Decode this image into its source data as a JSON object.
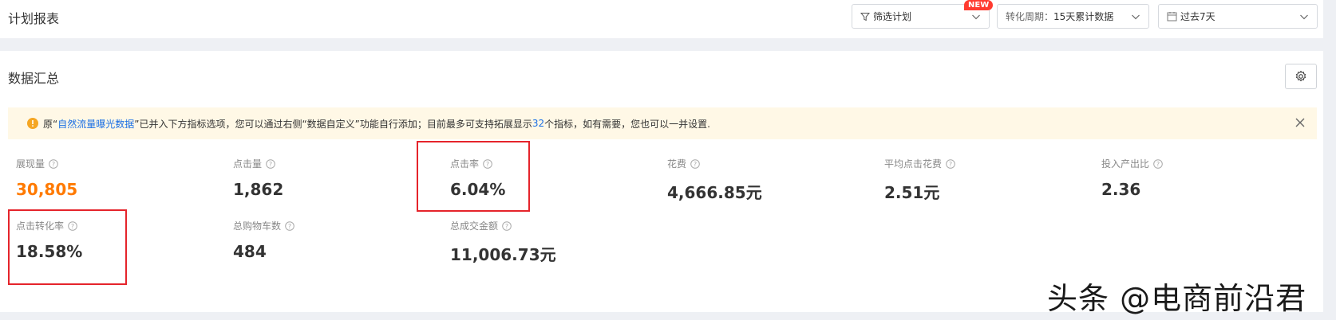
{
  "header": {
    "title": "计划报表",
    "filter_label": "筛选计划",
    "new_badge": "NEW",
    "cycle_prefix": "转化周期：",
    "cycle_value": "15天累计数据",
    "date_range": "过去7天"
  },
  "summary": {
    "title": "数据汇总",
    "notice": {
      "part1": "原“",
      "link1": "自然流量曝光数据",
      "part2": "”已并入下方指标选项，您可以通过右侧“数据自定义”功能自行添加；目前最多可支持拓展显示",
      "link2": "32",
      "part3": "个指标，如有需要，您也可以一并设置."
    },
    "metrics": [
      {
        "label": "展现量",
        "value": "30,805"
      },
      {
        "label": "点击量",
        "value": "1,862"
      },
      {
        "label": "点击率",
        "value": "6.04%"
      },
      {
        "label": "花费",
        "value": "4,666.85元"
      },
      {
        "label": "平均点击花费",
        "value": "2.51元"
      },
      {
        "label": "投入产出比",
        "value": "2.36"
      },
      {
        "label": "点击转化率",
        "value": "18.58%"
      },
      {
        "label": "总购物车数",
        "value": "484"
      },
      {
        "label": "总成交金额",
        "value": "11,006.73元"
      }
    ]
  },
  "watermark": "头条 @电商前沿君",
  "colors": {
    "accent_orange": "#ff7a00",
    "link_blue": "#1b6fe4",
    "highlight_red": "#e5242b",
    "notice_bg": "#fff8e6",
    "warn_icon": "#f5a623"
  }
}
